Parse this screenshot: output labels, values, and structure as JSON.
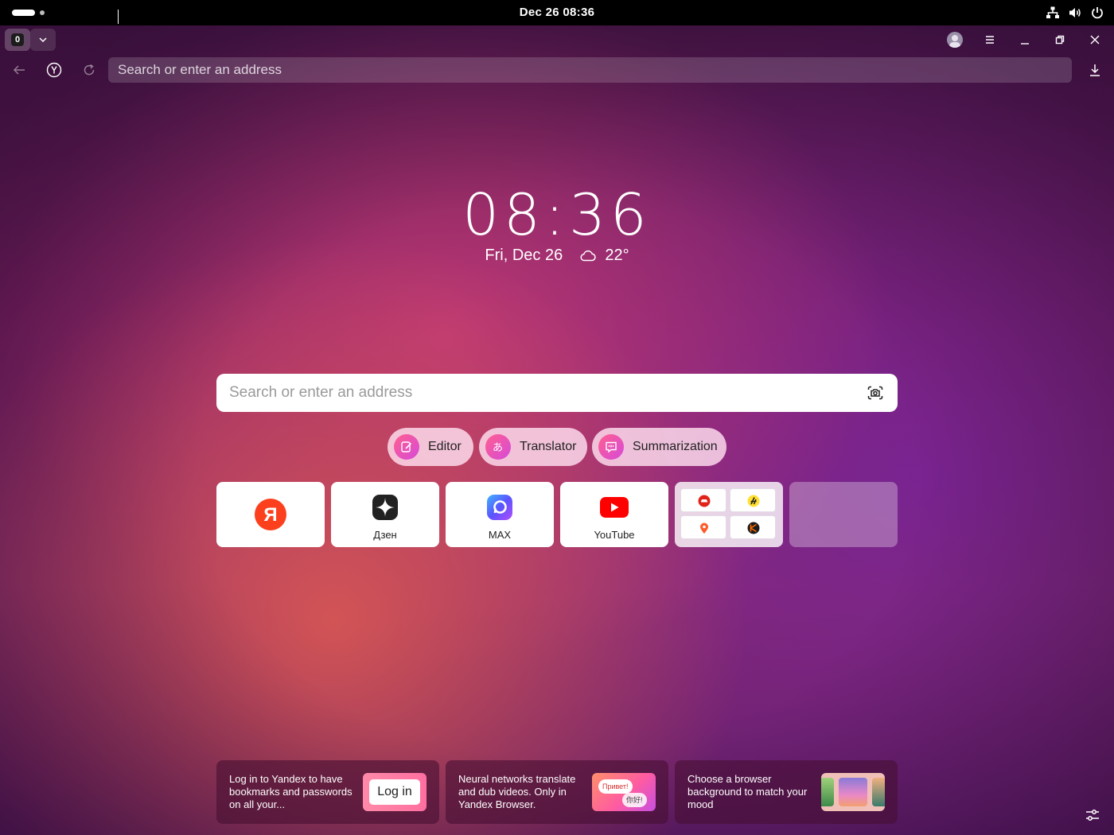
{
  "system": {
    "clock": "Dec 26  08:36",
    "tray_icons": [
      "network-icon",
      "volume-icon",
      "power-icon"
    ]
  },
  "browser": {
    "tab_count": "0",
    "address_placeholder": "Search or enter an address"
  },
  "newtab": {
    "time": "08:36",
    "date": "Fri, Dec 26",
    "weather": "22°",
    "weather_icon": "cloud-icon",
    "search_placeholder": "Search or enter an address",
    "chips": [
      {
        "label": "Editor",
        "icon": "editor-icon"
      },
      {
        "label": "Translator",
        "icon": "translator-icon"
      },
      {
        "label": "Summarization",
        "icon": "summarization-icon"
      }
    ],
    "tiles": [
      {
        "label": "",
        "icon": "yandex-logo-icon"
      },
      {
        "label": "Дзен",
        "icon": "dzen-icon"
      },
      {
        "label": "MAX",
        "icon": "max-icon"
      },
      {
        "label": "YouTube",
        "icon": "youtube-icon"
      }
    ],
    "promo": [
      {
        "text": "Log in to Yandex to have bookmarks and passwords on all your...",
        "button": "Log in"
      },
      {
        "text": "Neural networks translate and dub videos. Only in Yandex Browser.",
        "bubble_a": "Привет!",
        "bubble_b": "你好!"
      },
      {
        "text": "Choose a browser background to match your mood"
      }
    ]
  },
  "colors": {
    "accent_pink": "#e0458f",
    "youtube_red": "#ff0000",
    "yandex_red": "#fc3f1d"
  }
}
